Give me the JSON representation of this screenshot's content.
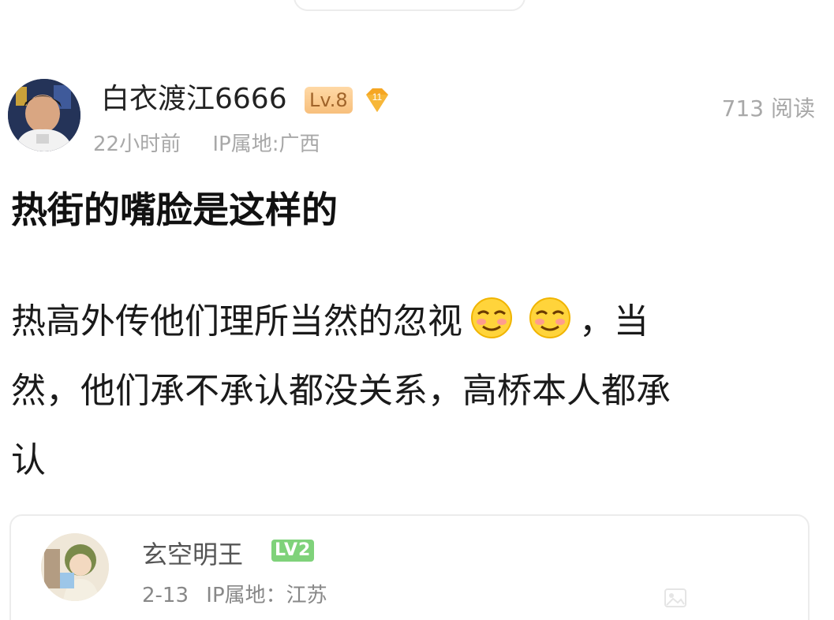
{
  "post": {
    "author": "白衣渡江6666",
    "level": "Lv.8",
    "gem_count": "11",
    "time": "22小时前",
    "ip": "IP属地:广西",
    "reads": "713 阅读",
    "title": "热街的嘴脸是这样的",
    "body": {
      "line1_text": "热高外传他们理所当然的忽视",
      "line1_end": "，当",
      "line2": "然，他们承不承认都没关系，高桥本人都承",
      "line3": "认",
      "emoji_icon": "smirk-emoji-icon"
    }
  },
  "reply": {
    "author": "玄空明王",
    "level": "LV2",
    "date": "2-13",
    "ip": "IP属地：江苏"
  },
  "colors": {
    "muted": "#a8a8a8",
    "level_badge": "#f7bf7c",
    "gem": "#f5a623",
    "lv2_badge": "#7fd27a"
  }
}
